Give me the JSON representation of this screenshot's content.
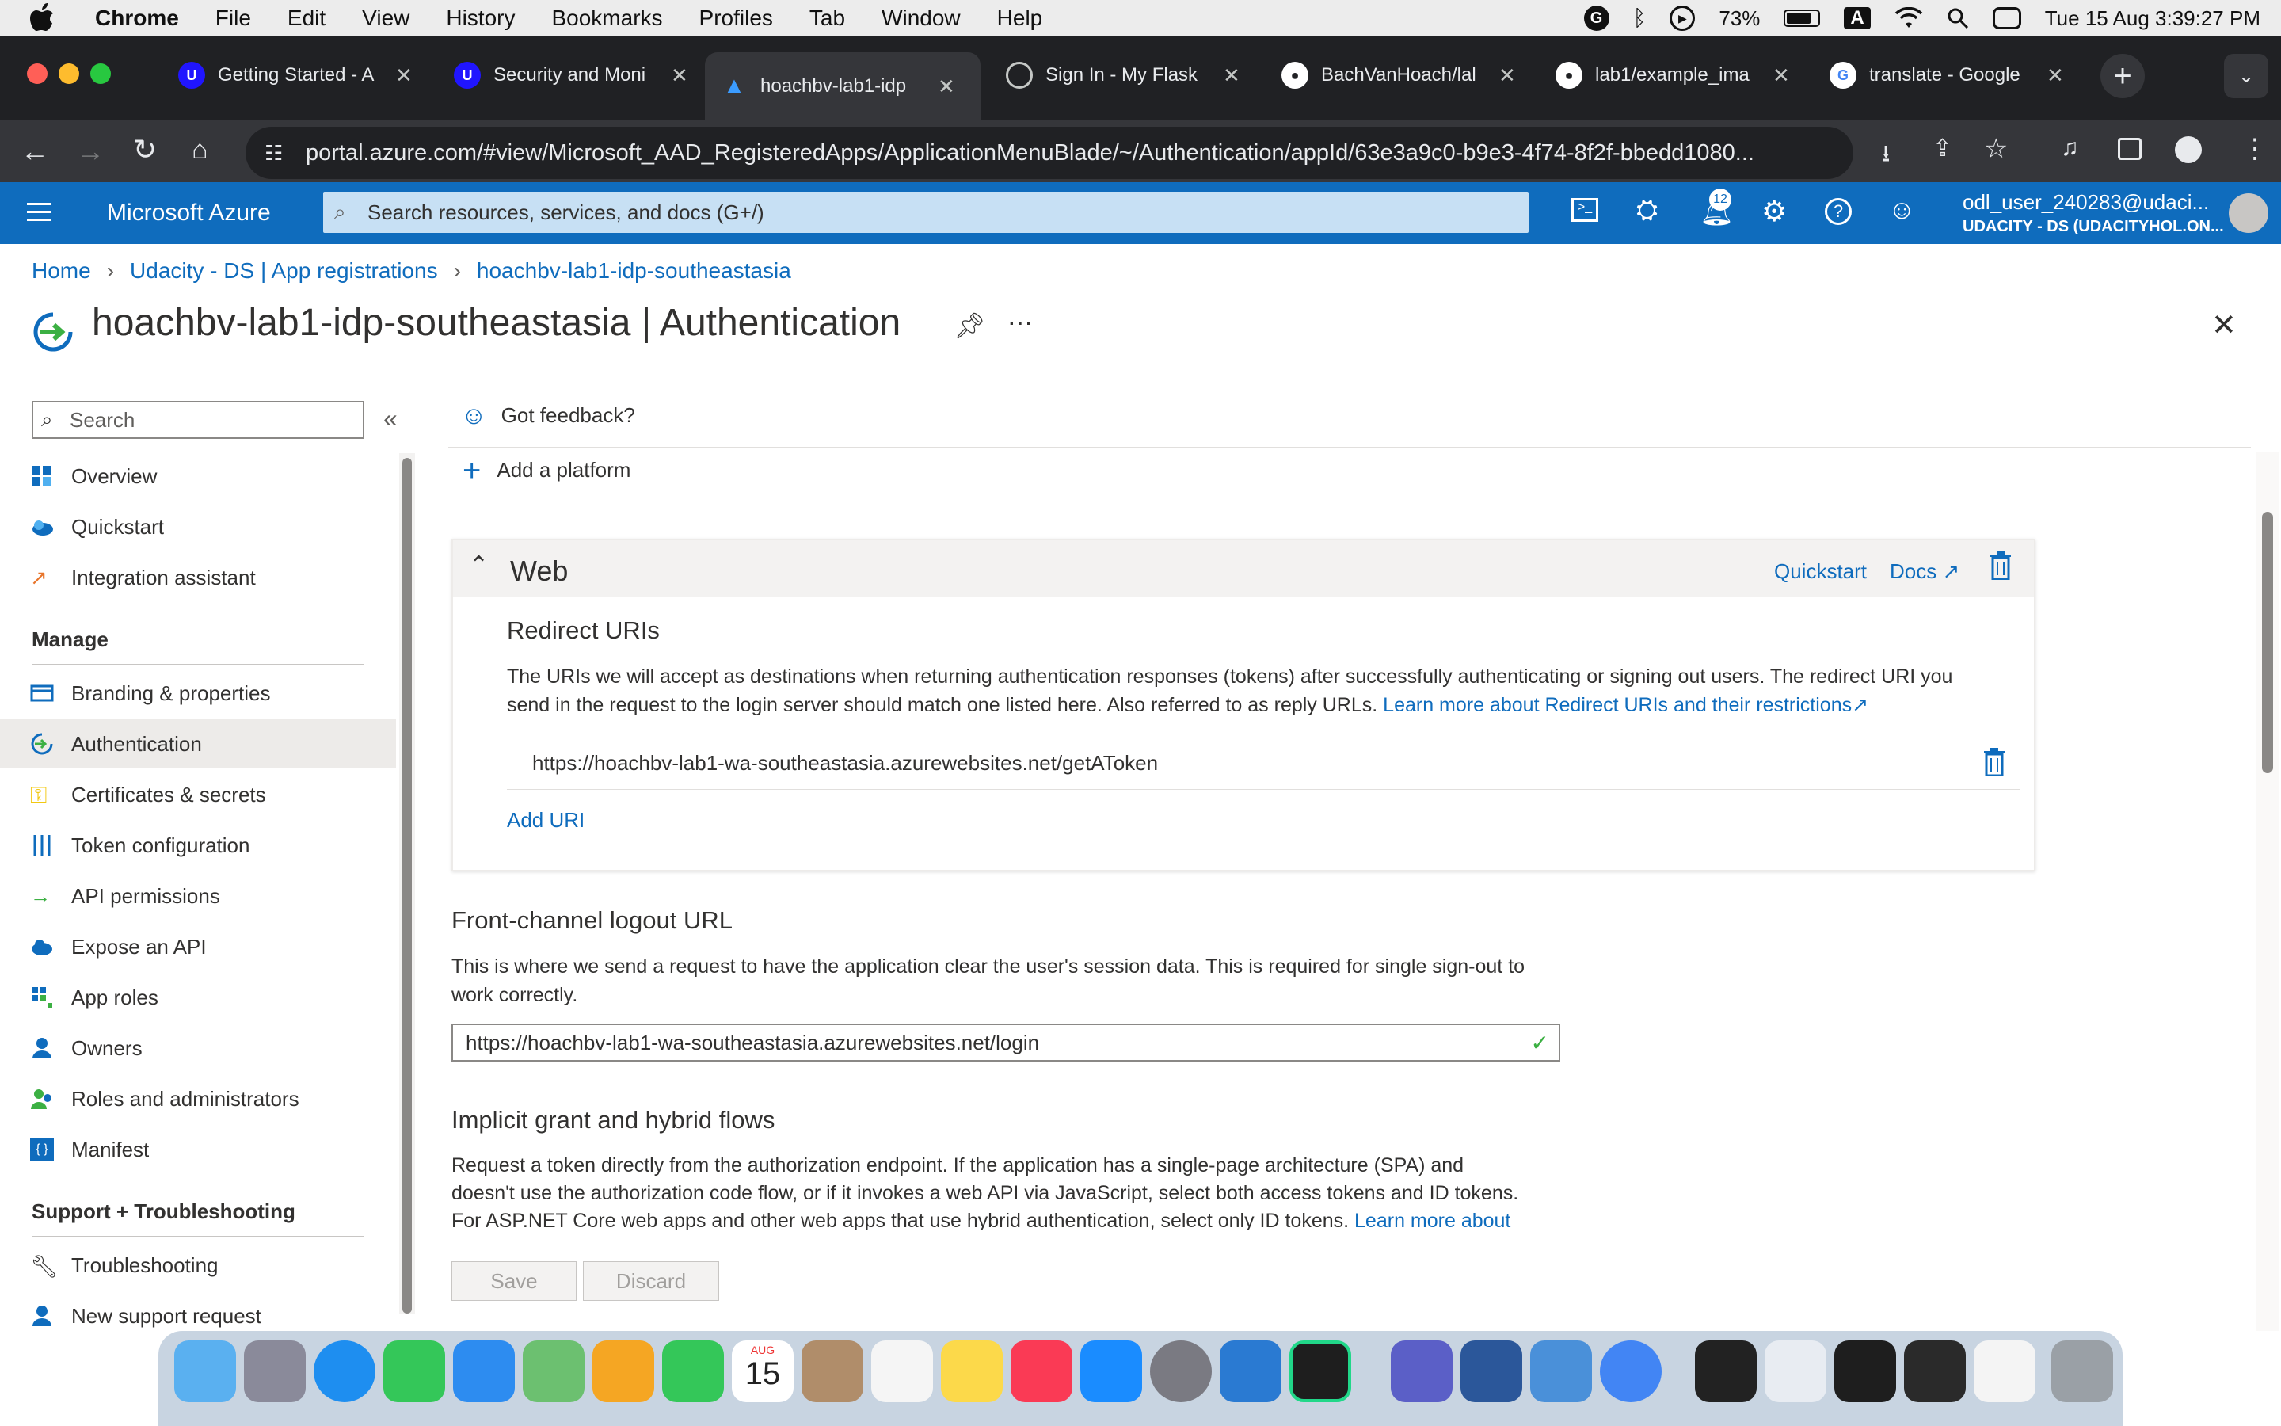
{
  "menubar": {
    "app": "Chrome",
    "items": [
      "File",
      "Edit",
      "View",
      "History",
      "Bookmarks",
      "Profiles",
      "Tab",
      "Window",
      "Help"
    ],
    "battery": "73%",
    "datetime": "Tue 15 Aug  3:39:27 PM",
    "input_source": "A"
  },
  "tabs": [
    {
      "label": "Getting Started - A",
      "icon": "udacity-icon"
    },
    {
      "label": "Security and Moni",
      "icon": "udacity-icon"
    },
    {
      "label": "hoachbv-lab1-idp",
      "icon": "azure-icon",
      "active": true
    },
    {
      "label": "Sign In - My Flask",
      "icon": "globe-icon"
    },
    {
      "label": "BachVanHoach/lal",
      "icon": "github-icon"
    },
    {
      "label": "lab1/example_ima",
      "icon": "github-icon"
    },
    {
      "label": "translate - Google",
      "icon": "google-icon"
    }
  ],
  "url": "portal.azure.com/#view/Microsoft_AAD_RegisteredApps/ApplicationMenuBlade/~/Authentication/appId/63e3a9c0-b9e3-4f74-8f2f-bbedd1080...",
  "azure": {
    "brand": "Microsoft Azure",
    "search_placeholder": "Search resources, services, and docs (G+/)",
    "notifications": "12",
    "user_name": "odl_user_240283@udaci...",
    "user_tenant": "UDACITY - DS (UDACITYHOL.ON..."
  },
  "breadcrumb": [
    "Home",
    "Udacity - DS | App registrations",
    "hoachbv-lab1-idp-southeastasia"
  ],
  "page_title": "hoachbv-lab1-idp-southeastasia | Authentication",
  "sidebar": {
    "search_placeholder": "Search",
    "items_top": [
      "Overview",
      "Quickstart",
      "Integration assistant"
    ],
    "manage_label": "Manage",
    "manage_items": [
      "Branding & properties",
      "Authentication",
      "Certificates & secrets",
      "Token configuration",
      "API permissions",
      "Expose an API",
      "App roles",
      "Owners",
      "Roles and administrators",
      "Manifest"
    ],
    "support_label": "Support + Troubleshooting",
    "support_items": [
      "Troubleshooting",
      "New support request"
    ]
  },
  "content": {
    "feedback": "Got feedback?",
    "add_platform": "Add a platform",
    "web": {
      "title": "Web",
      "quickstart": "Quickstart",
      "docs": "Docs",
      "redirect_title": "Redirect URIs",
      "redirect_desc_1": "The URIs we will accept as destinations when returning authentication responses (tokens) after successfully authenticating or signing out users. The redirect URI you",
      "redirect_desc_2": "send in the request to the login server should match one listed here. Also referred to as reply URLs.",
      "redirect_link": "Learn more about Redirect URIs and their restrictions",
      "redirect_uri": "https://hoachbv-lab1-wa-southeastasia.azurewebsites.net/getAToken",
      "add_uri": "Add URI"
    },
    "logout": {
      "title": "Front-channel logout URL",
      "desc_1": "This is where we send a request to have the application clear the user's session data. This is required for single sign-out to",
      "desc_2": "work correctly.",
      "value": "https://hoachbv-lab1-wa-southeastasia.azurewebsites.net/login"
    },
    "implicit": {
      "title": "Implicit grant and hybrid flows",
      "desc_1": "Request a token directly from the authorization endpoint. If the application has a single-page architecture (SPA) and",
      "desc_2": "doesn't use the authorization code flow, or if it invokes a web API via JavaScript, select both access tokens and ID tokens.",
      "desc_3": "For ASP.NET Core web apps and other web apps that use hybrid authentication, select only ID tokens.",
      "link": "Learn more about"
    },
    "save": "Save",
    "discard": "Discard"
  },
  "dock": {
    "calendar_month": "AUG",
    "calendar_day": "15"
  },
  "colors": {
    "azure_blue": "#0f6cbd",
    "link": "#0f6cbd",
    "chrome_dark": "#202124"
  }
}
